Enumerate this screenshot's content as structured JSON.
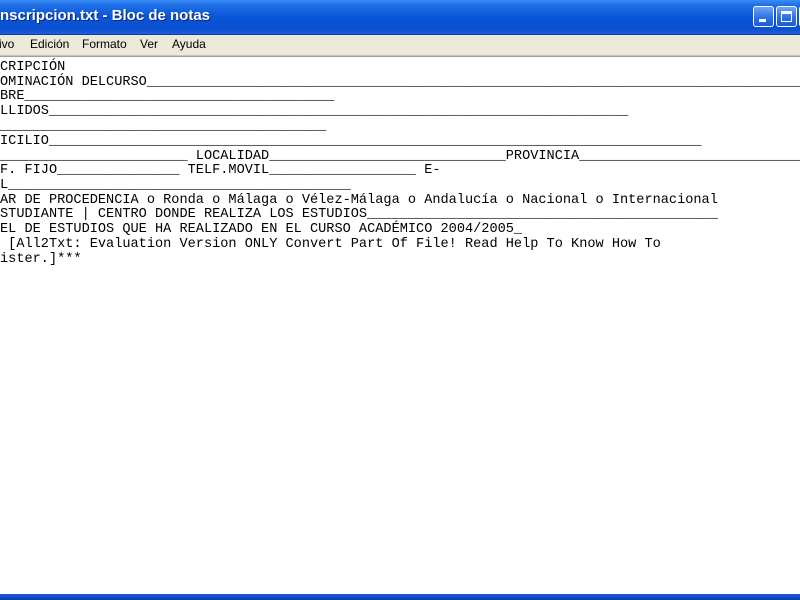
{
  "window": {
    "title": "nscripcion.txt - Bloc de notas",
    "controls": [
      "minimize",
      "maximize",
      "close"
    ],
    "accent_color": "#0a55d8",
    "close_color": "#d8502e"
  },
  "menu": {
    "items": [
      {
        "label": "ivo"
      },
      {
        "label": "Edición"
      },
      {
        "label": "Formato"
      },
      {
        "label": "Ver"
      },
      {
        "label": "Ayuda"
      }
    ]
  },
  "document": {
    "lines": [
      "CRIPCIÓN",
      "OMINACIÓN DELCURSO__________________________________________________________________________________________",
      "BRE______________________________________",
      "LLIDOS_______________________________________________________________________",
      "________________________________________",
      "ICILIO________________________________________________________________________________",
      "_______________________ LOCALIDAD_____________________________PROVINCIA____________________________",
      "F. FIJO_______________ TELF.MOVIL__________________ E-",
      "L__________________________________________",
      "AR DE PROCEDENCIA o Ronda o Málaga o Vélez-Málaga o Andalucía o Nacional o Internacional",
      "STUDIANTE | CENTRO DONDE REALIZA LOS ESTUDIOS___________________________________________",
      "EL DE ESTUDIOS QUE HA REALIZADO EN EL CURSO ACADÉMICO 2004/2005_",
      " [All2Txt: Evaluation Version ONLY Convert Part Of File! Read Help To Know How To",
      "ister.]***"
    ]
  }
}
